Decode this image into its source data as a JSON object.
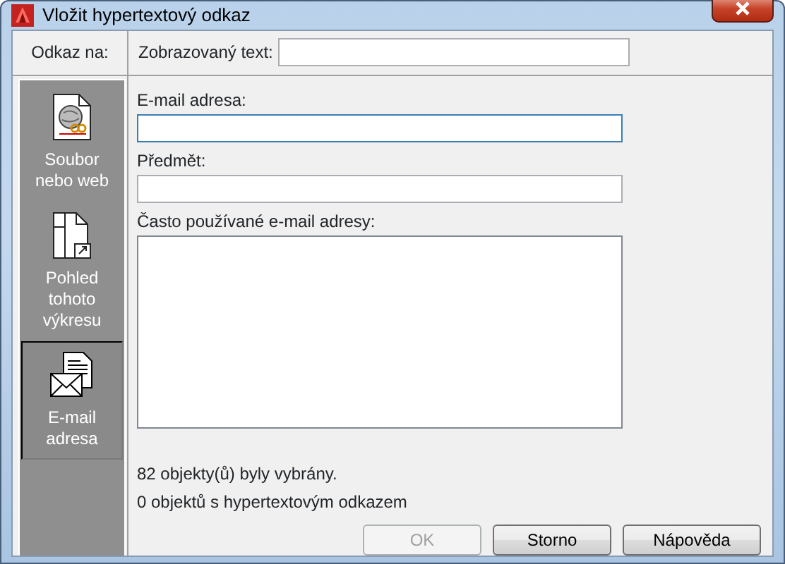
{
  "window": {
    "title": "Vložit hypertextový odkaz"
  },
  "link_to": {
    "label": "Odkaz na:"
  },
  "sidebar": {
    "items": [
      {
        "label": "Soubor nebo web",
        "kind": "file",
        "selected": false
      },
      {
        "label": "Pohled tohoto výkresu",
        "kind": "view",
        "selected": false
      },
      {
        "label": "E-mail adresa",
        "kind": "email",
        "selected": true
      }
    ]
  },
  "display_text": {
    "label": "Zobrazovaný text:"
  },
  "fields": [
    {
      "label": "E-mail adresa:",
      "kind": "input"
    },
    {
      "label": "Předmět:",
      "kind": "input"
    },
    {
      "label": "Často používané e-mail adresy:",
      "kind": "list"
    }
  ],
  "status": [
    "82 objekty(ů) byly vybrány.",
    "0 objektů s hypertextovým odkazem"
  ],
  "buttons": [
    {
      "label": "OK",
      "disabled": true
    },
    {
      "label": "Storno",
      "disabled": false
    },
    {
      "label": "Nápověda",
      "disabled": false
    }
  ]
}
